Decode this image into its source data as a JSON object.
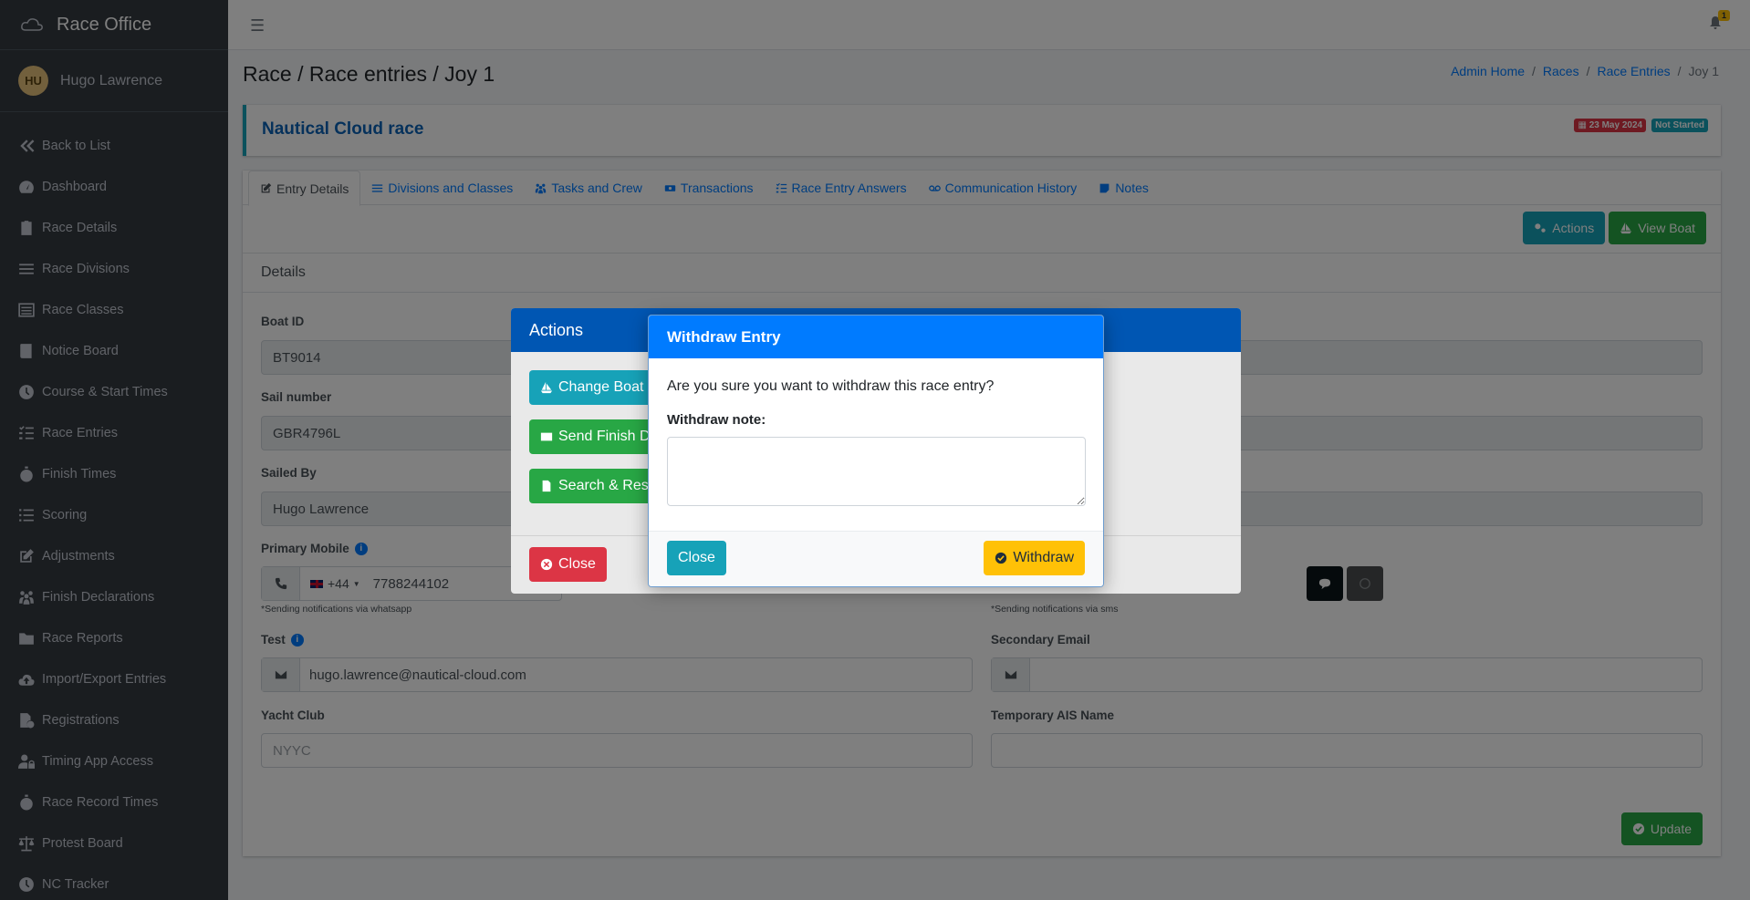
{
  "brand": {
    "title": "Race Office"
  },
  "user": {
    "initials": "HU",
    "name": "Hugo Lawrence"
  },
  "sidebar": {
    "items": [
      {
        "label": "Back to List",
        "icon": "double-chevron-left-icon"
      },
      {
        "label": "Dashboard",
        "icon": "gauge-icon"
      },
      {
        "label": "Race Details",
        "icon": "clipboard-icon"
      },
      {
        "label": "Race Divisions",
        "icon": "bars-icon"
      },
      {
        "label": "Race Classes",
        "icon": "list-icon"
      },
      {
        "label": "Notice Board",
        "icon": "book-icon"
      },
      {
        "label": "Course & Start Times",
        "icon": "clock-icon"
      },
      {
        "label": "Race Entries",
        "icon": "list-check-icon"
      },
      {
        "label": "Finish Times",
        "icon": "stopwatch-icon"
      },
      {
        "label": "Scoring",
        "icon": "list-ol-icon"
      },
      {
        "label": "Adjustments",
        "icon": "edit-icon"
      },
      {
        "label": "Finish Declarations",
        "icon": "people-icon"
      },
      {
        "label": "Race Reports",
        "icon": "folder-icon"
      },
      {
        "label": "Import/Export Entries",
        "icon": "cloud-upload-icon"
      },
      {
        "label": "Registrations",
        "icon": "file-clock-icon"
      },
      {
        "label": "Timing App Access",
        "icon": "user-lock-icon"
      },
      {
        "label": "Race Record Times",
        "icon": "stopwatch-icon"
      },
      {
        "label": "Protest Board",
        "icon": "scale-icon"
      },
      {
        "label": "NC Tracker",
        "icon": "clock-icon"
      }
    ]
  },
  "topbar": {
    "notification_count": "1"
  },
  "page": {
    "title": "Race / Race entries / Joy 1"
  },
  "breadcrumb": {
    "items": [
      "Admin Home",
      "Races",
      "Race Entries"
    ],
    "active": "Joy 1"
  },
  "race": {
    "name": "Nautical Cloud race",
    "date_badge": "23 May 2024",
    "status_badge": "Not Started"
  },
  "tabs": [
    {
      "label": "Entry Details",
      "icon": "edit-icon"
    },
    {
      "label": "Divisions and Classes",
      "icon": "bars-icon"
    },
    {
      "label": "Tasks and Crew",
      "icon": "people-icon"
    },
    {
      "label": "Transactions",
      "icon": "money-icon"
    },
    {
      "label": "Race Entry Answers",
      "icon": "list-check-icon"
    },
    {
      "label": "Communication History",
      "icon": "voicemail-icon"
    },
    {
      "label": "Notes",
      "icon": "note-icon"
    }
  ],
  "toolbar": {
    "actions_label": "Actions",
    "view_boat_label": "View Boat"
  },
  "details": {
    "heading": "Details",
    "boat_id_label": "Boat ID",
    "boat_id": "BT9014",
    "sail_number_label": "Sail number",
    "sail_number": "GBR4796L",
    "sailed_by_label": "Sailed By",
    "sailed_by": "Hugo Lawrence",
    "primary_mobile_label": "Primary Mobile",
    "country_code": "+44",
    "primary_mobile": "7788244102",
    "whatsapp_hint": "*Sending notifications via whatsapp",
    "sms_hint": "*Sending notifications via sms",
    "test_label": "Test",
    "test_email": "hugo.lawrence@nautical-cloud.com",
    "secondary_email_label": "Secondary Email",
    "yacht_club_label": "Yacht Club",
    "yacht_club": "NYYC",
    "ais_label": "Temporary AIS Name",
    "update_label": "Update"
  },
  "actions_modal": {
    "title": "Actions",
    "change_boat": "Change Boat",
    "send_finish": "Send Finish D",
    "search_res": "Search & Res",
    "close": "Close"
  },
  "withdraw_modal": {
    "title": "Withdraw Entry",
    "question": "Are you sure you want to withdraw this race entry?",
    "note_label": "Withdraw note:",
    "note_value": "",
    "close_label": "Close",
    "withdraw_label": "Withdraw"
  },
  "colors": {
    "sidebar_bg": "#343a40",
    "primary": "#007bff",
    "info": "#17a2b8",
    "success": "#28a745",
    "danger": "#dc3545",
    "warning": "#ffc107"
  }
}
